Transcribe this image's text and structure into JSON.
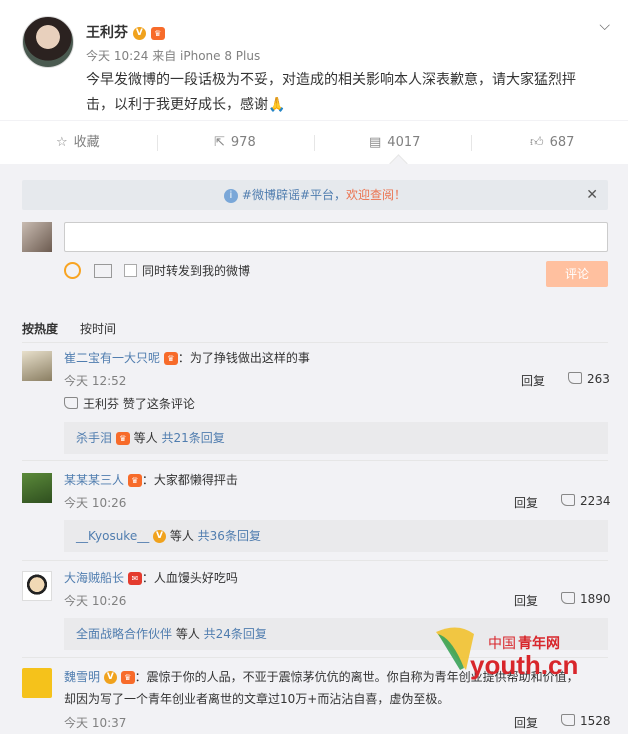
{
  "post": {
    "author": "王利芬",
    "meta": "今天 10:24 来自 iPhone 8 Plus",
    "text_line1": "今早发微博的一段话极为不妥，对造成的相关影响本人深表歉意，请大家猛烈抨",
    "text_line2": "击，以利于我更好成长，感谢🙏"
  },
  "actions": {
    "favorite": "收藏",
    "repost": "978",
    "comment": "4017",
    "like": "687"
  },
  "notice": {
    "prefix": "#微博辟谣#平台，",
    "link": "欢迎查阅！"
  },
  "composer": {
    "forward_label": "同时转发到我的微博",
    "submit": "评论"
  },
  "sort": {
    "hot": "按热度",
    "time": "按时间"
  },
  "comments": [
    {
      "user": "崔二宝有一大只呢",
      "text": "：为了挣钱做出这样的事",
      "time": "今天 12:52",
      "reply": "回复",
      "likes": "263",
      "liked_by": "王利芬 赞了这条评论",
      "sub_user": "杀手泪",
      "sub_mid": " 等人 ",
      "sub_count": "共21条回复"
    },
    {
      "user": "某某某三人",
      "text": "：大家都懒得抨击",
      "time": "今天 10:26",
      "reply": "回复",
      "likes": "2234",
      "sub_user": "__Kyosuke__",
      "sub_mid": " 等人 ",
      "sub_count": "共36条回复"
    },
    {
      "user": "大海贼船长",
      "text": "：人血馒头好吃吗",
      "time": "今天 10:26",
      "reply": "回复",
      "likes": "1890",
      "sub_user": "全面战略合作伙伴",
      "sub_mid": " 等人 ",
      "sub_count": "共24条回复"
    },
    {
      "user": "魏雪明",
      "text": "：震惊于你的人品，不亚于震惊茅伉伉的离世。你自称为青年创业提供帮助和价值，",
      "text2": "却因为写了一个青年创业者离世的文章过10万+而沾沾自喜，虚伪至极。",
      "time": "今天 10:37",
      "reply": "回复",
      "likes": "1528"
    }
  ],
  "watermark": {
    "cn": "中国",
    "brand": "青年网",
    "latin": "youth.cn"
  },
  "colors": {
    "accent": "#eb7350",
    "link": "#507daf",
    "panel": "#f2f2f5"
  }
}
